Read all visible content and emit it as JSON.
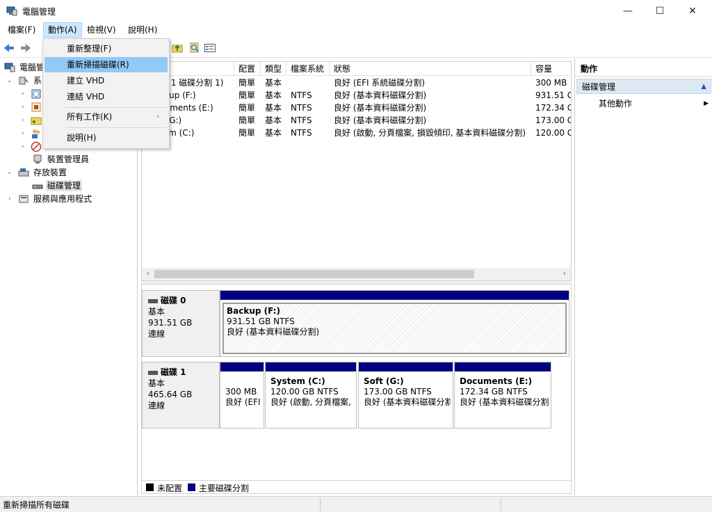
{
  "window": {
    "title": "電腦管理",
    "minimize": "—",
    "maximize": "☐",
    "close": "✕"
  },
  "menubar": [
    "檔案(F)",
    "動作(A)",
    "檢視(V)",
    "說明(H)"
  ],
  "dropdown": {
    "items": [
      "重新整理(F)",
      "重新掃描磁碟(R)",
      "建立 VHD",
      "連結 VHD",
      "所有工作(K)",
      "說明(H)"
    ],
    "submenu_arrow": "›"
  },
  "tree": {
    "root": "電腦管",
    "system_tools": "系",
    "device_manager": "裝置管理員",
    "storage": "存放裝置",
    "disk_management": "磁碟管理",
    "services": "服務與應用程式"
  },
  "volume_table": {
    "headers": [
      "",
      "配置",
      "類型",
      "檔案系統",
      "狀態",
      "容量"
    ],
    "rows": [
      [
        "碟 1 磁碟分割 1)",
        "簡單",
        "基本",
        "",
        "良好 (EFI 系統磁碟分割)",
        "300 MB"
      ],
      [
        "ckup (F:)",
        "簡單",
        "基本",
        "NTFS",
        "良好 (基本資料磁碟分割)",
        "931.51 G"
      ],
      [
        "cuments (E:)",
        "簡單",
        "基本",
        "NTFS",
        "良好 (基本資料磁碟分割)",
        "172.34 G"
      ],
      [
        "t (G:)",
        "簡單",
        "基本",
        "NTFS",
        "良好 (基本資料磁碟分割)",
        "173.00 G"
      ],
      [
        "tem (C:)",
        "簡單",
        "基本",
        "NTFS",
        "良好 (啟動, 分頁檔案, 損毀傾印, 基本資料磁碟分割)",
        "120.00 G"
      ]
    ]
  },
  "disks": [
    {
      "name": "磁碟 0",
      "type": "基本",
      "size": "931.51 GB",
      "status": "連線",
      "partitions": [
        {
          "name": "Backup  (F:)",
          "size": "931.51 GB NTFS",
          "status": "良好 (基本資料磁碟分割)"
        }
      ]
    },
    {
      "name": "磁碟 1",
      "type": "基本",
      "size": "465.64 GB",
      "status": "連線",
      "partitions": [
        {
          "name": "",
          "size": "300 MB",
          "status": "良好 (EFI"
        },
        {
          "name": "System  (C:)",
          "size": "120.00 GB NTFS",
          "status": "良好 (啟動, 分頁檔案,"
        },
        {
          "name": "Soft  (G:)",
          "size": "173.00 GB NTFS",
          "status": "良好 (基本資料磁碟分割"
        },
        {
          "name": "Documents  (E:)",
          "size": "172.34 GB NTFS",
          "status": "良好 (基本資料磁碟分割"
        }
      ]
    }
  ],
  "legend": {
    "unallocated": "未配置",
    "primary": "主要磁碟分割",
    "unallocated_color": "#000000",
    "primary_color": "#000080"
  },
  "actions": {
    "header": "動作",
    "section": "磁碟管理",
    "more": "其他動作"
  },
  "status": {
    "text": "重新掃描所有磁碟"
  },
  "colors": {
    "partition_bar": "#000080",
    "menu_highlight": "#91c9f7",
    "action_section": "#dde8f5"
  }
}
